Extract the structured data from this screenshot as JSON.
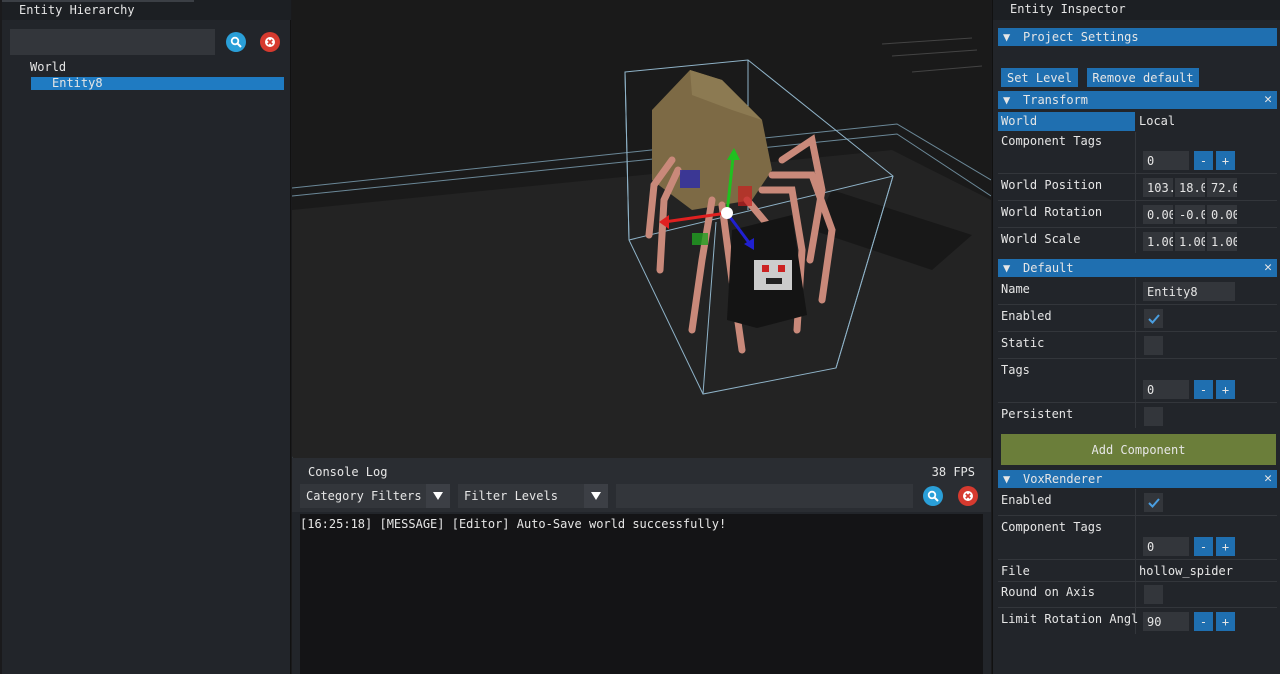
{
  "hierarchy": {
    "title": "Entity Hierarchy",
    "search_placeholder": "",
    "tree": {
      "root": "World",
      "selected_entity": "Entity8"
    }
  },
  "console": {
    "title": "Console Log",
    "fps": "38 FPS",
    "category_filter": "Category Filters",
    "level_filter": "Filter Levels",
    "search_value": "",
    "log": [
      "[16:25:18] [MESSAGE] [Editor] Auto-Save world successfully!"
    ]
  },
  "inspector": {
    "title": "Entity Inspector",
    "project_settings": "Project Settings",
    "set_level": "Set Level",
    "remove_default": "Remove default",
    "transform": {
      "header": "Transform",
      "space_world": "World",
      "space_local": "Local",
      "component_tags_label": "Component Tags",
      "component_tags_value": "0",
      "world_position_label": "World Position",
      "world_position": [
        "103.",
        "18.0",
        "72.0"
      ],
      "world_rotation_label": "World Rotation",
      "world_rotation": [
        "0.00",
        "-0.0",
        "0.00"
      ],
      "world_scale_label": "World Scale",
      "world_scale": [
        "1.00",
        "1.00",
        "1.00"
      ]
    },
    "default": {
      "header": "Default",
      "name_label": "Name",
      "name_value": "Entity8",
      "enabled_label": "Enabled",
      "static_label": "Static",
      "tags_label": "Tags",
      "tags_value": "0",
      "persistent_label": "Persistent",
      "add_component": "Add Component"
    },
    "voxrenderer": {
      "header": "VoxRenderer",
      "enabled_label": "Enabled",
      "component_tags_label": "Component Tags",
      "component_tags_value": "0",
      "file_label": "File",
      "file_value": "hollow_spider",
      "round_on_axis_label": "Round on Axis",
      "limit_rotation_label": "Limit Rotation Angl",
      "limit_rotation_value": "90"
    },
    "symbols": {
      "triangle": "▼",
      "close": "✕",
      "minus": "-",
      "plus": "+"
    }
  },
  "colors": {
    "accent": "#1f6fb0",
    "add_component": "#6b7e3a",
    "search_btn": "#2a9fd8",
    "clear_btn": "#d63a2f"
  }
}
